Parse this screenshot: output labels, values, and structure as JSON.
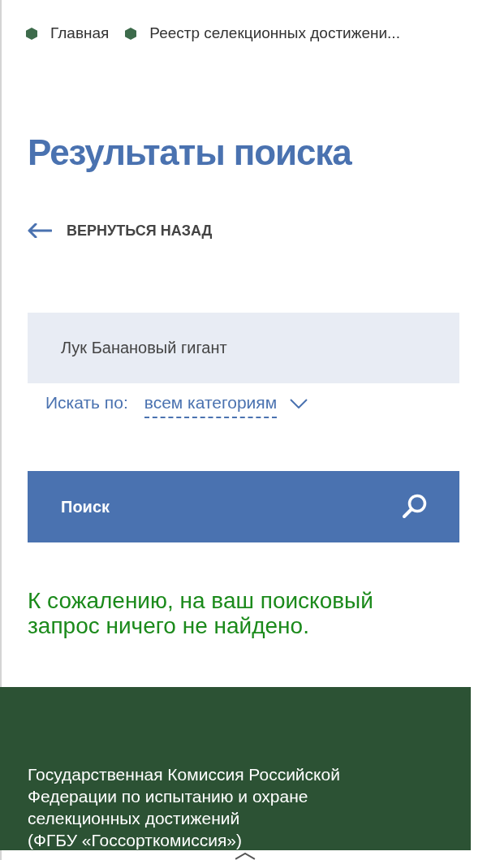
{
  "breadcrumbs": [
    {
      "label": "Главная"
    },
    {
      "label": "Реестр селекционных достижени..."
    }
  ],
  "page_title": "Результаты поиска",
  "back_link": {
    "label": "ВЕРНУТЬСЯ НАЗАД"
  },
  "search": {
    "value": "Лук Банановый гигант",
    "filter_label": "Искать по:",
    "filter_value": "всем категориям",
    "button": "Поиск"
  },
  "message": "К сожалению, на ваш поисковый запрос ничего не найдено.",
  "footer": {
    "org_name": "Государственная Комиссия Российской Федерации по испытанию и охране селекционных достижений",
    "org_short": "(ФГБУ «Госсорткомиссия»)"
  }
}
